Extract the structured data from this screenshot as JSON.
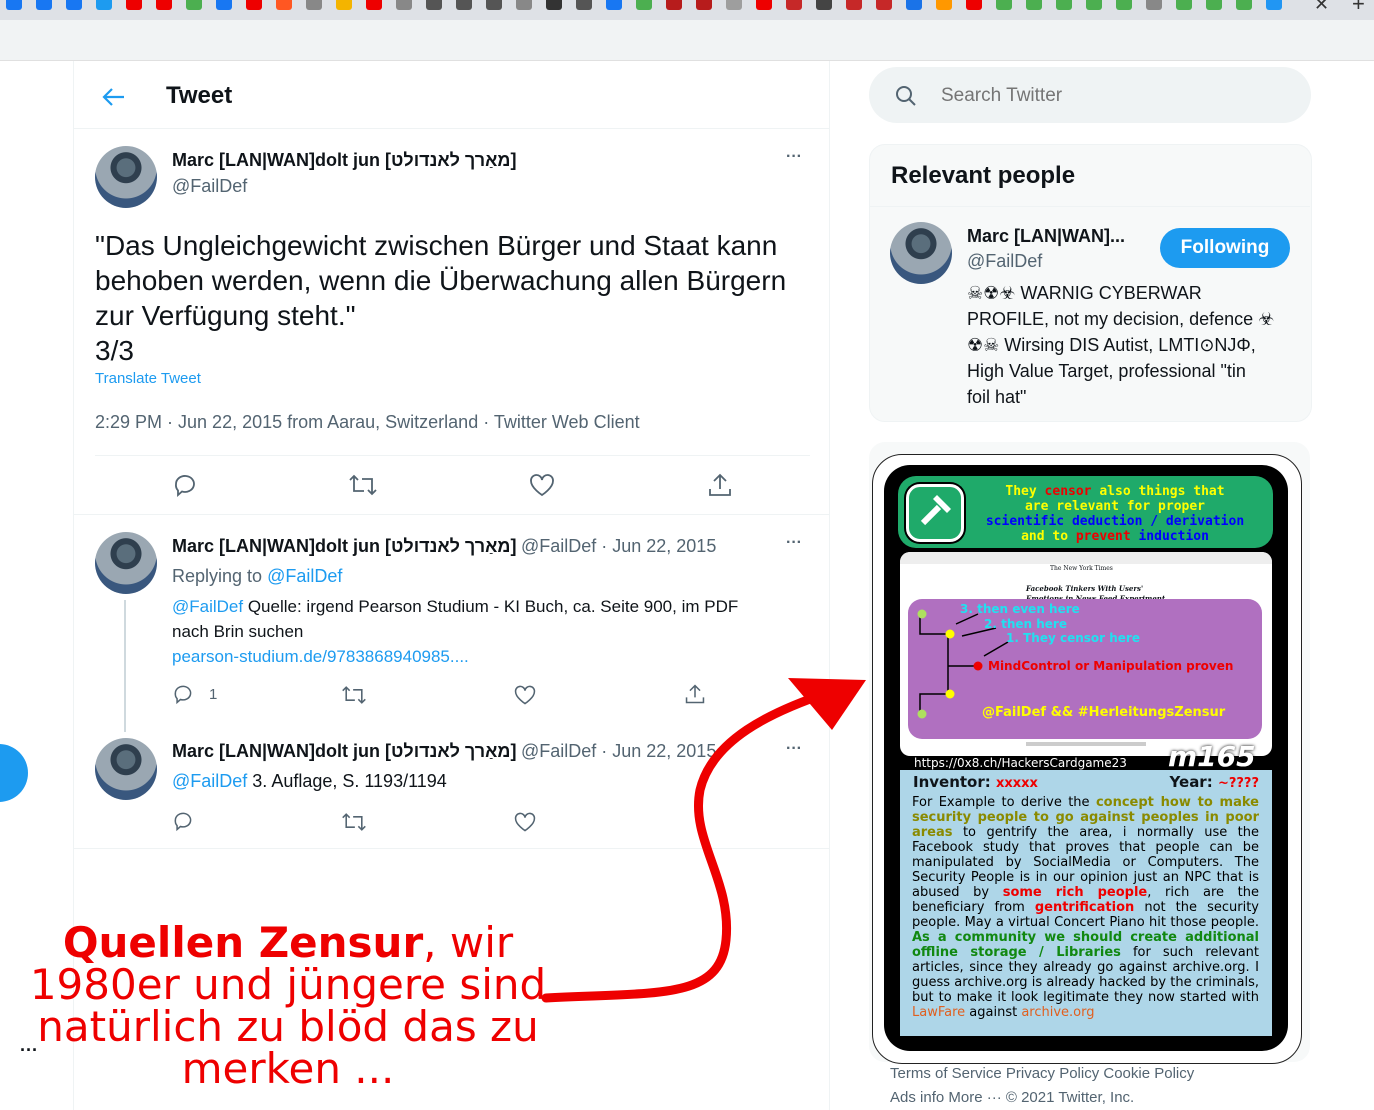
{
  "header": {
    "title": "Tweet"
  },
  "main_tweet": {
    "author_name": "Marc [LAN|WAN]dolt jun [מאַרך לאנדולט]",
    "handle": "@FailDef",
    "text_lines": [
      "\"Das Ungleichgewicht zwischen Bürger und Staat kann",
      "behoben werden, wenn die Überwachung allen Bürgern",
      "zur Verfügung steht.\"",
      "3/3"
    ],
    "translate": "Translate Tweet",
    "meta": "2:29 PM · Jun 22, 2015 from Aarau, Switzerland · Twitter Web Client",
    "more": "···"
  },
  "replies": [
    {
      "author_name": "Marc [LAN|WAN]dolt jun [מאַרך לאנדולט]",
      "meta": "@FailDef · Jun 22, 2015",
      "replying_prefix": "Replying to ",
      "replying_handle": "@FailDef",
      "mention": "@FailDef",
      "text": " Quelle: irgend Pearson Studium - KI Buch, ca. Seite 900, im PDF",
      "text2": "nach Brin suchen",
      "link": "pearson-studium.de/9783868940985....",
      "reply_count": "1",
      "more": "···"
    },
    {
      "author_name": "Marc [LAN|WAN]dolt jun [מאַרך לאנדולט]",
      "meta": "@FailDef · Jun 22, 2015",
      "mention": "@FailDef",
      "text": " 3. Auflage, S. 1193/1194",
      "more": "···"
    }
  ],
  "sidebar_more": "···",
  "search": {
    "placeholder": "Search Twitter"
  },
  "relevant_people": {
    "title": "Relevant people",
    "name": "Marc [LAN|WAN]...",
    "handle": "@FailDef",
    "follow_label": "Following",
    "bio_lines": [
      "☠☢☣ WARNIG CYBERWAR",
      "PROFILE, not my decision, defence ☣",
      "☢☠ Wirsing DIS Autist, LMTI⊙NJΦ,",
      "High Value Target, professional \"tin",
      "foil hat\""
    ]
  },
  "card": {
    "top_line1_a": "They ",
    "top_line1_b": "censor",
    "top_line1_c": " also things that",
    "top_line2": "are relevant for proper",
    "top_line3": "scientific deduction / derivation",
    "top_line4_a": "and to ",
    "top_line4_b": "prevent",
    "top_line4_c": " induction",
    "diagram": {
      "l3": "3. then even here",
      "l2": "2. then here",
      "l1": "1. They censor here",
      "mind": "MindControl or Manipulation proven",
      "tag": "@FailDef && #HerleitungsZensur"
    },
    "screen": {
      "site": "The New York Times",
      "headline1": "Facebook Tinkers With Users'",
      "headline2": "Emotions in News Feed Experiment,"
    },
    "url": "https://0x8.ch/HackersCardgame23",
    "code": "m165",
    "inventor_label": "Inventor: ",
    "inventor_value": "xxxxx",
    "year_label": "Year: ",
    "year_value": "~????",
    "body": [
      {
        "t": "For Example to derive the ",
        "c": "n"
      },
      {
        "t": "concept how to make security people to go against peoples in poor areas",
        "c": "o"
      },
      {
        "t": " to gentrify the area, i normally use the Facebook study that proves that people can be manipulated by SocialMedia or Computers. The Security People is in our opinion just an NPC that is abused by ",
        "c": "n"
      },
      {
        "t": "some rich people",
        "c": "r"
      },
      {
        "t": ", rich are the beneficiary from ",
        "c": "n"
      },
      {
        "t": "gentrification",
        "c": "r"
      },
      {
        "t": " not the security people. May a virtual Concert Piano hit those people. ",
        "c": "n"
      },
      {
        "t": "As a community we should create additional offline storage / Libraries",
        "c": "g"
      },
      {
        "t": " for such relevant articles, since they already go against archive.org. I guess archive.org is already hacked by the criminals, but to make it look legitimate they now started with ",
        "c": "n"
      },
      {
        "t": "LawFare",
        "c": "l"
      },
      {
        "t": " against ",
        "c": "n"
      },
      {
        "t": "archive.org",
        "c": "l"
      }
    ]
  },
  "footer": {
    "line1": "Terms of Service   Privacy Policy   Cookie Policy",
    "line2": "Ads info   More ···   © 2021 Twitter, Inc."
  },
  "annotation": {
    "bold": "Quellen Zensur",
    "rest": ", wir 1980er und jüngere sind natürlich zu blöd das zu merken ..."
  },
  "colors": {
    "accent": "#1d9bf0",
    "annotation": "#ee0000",
    "card_green": "#1faa6a",
    "card_purple": "#b070c0",
    "card_blue": "#aed6e8"
  }
}
